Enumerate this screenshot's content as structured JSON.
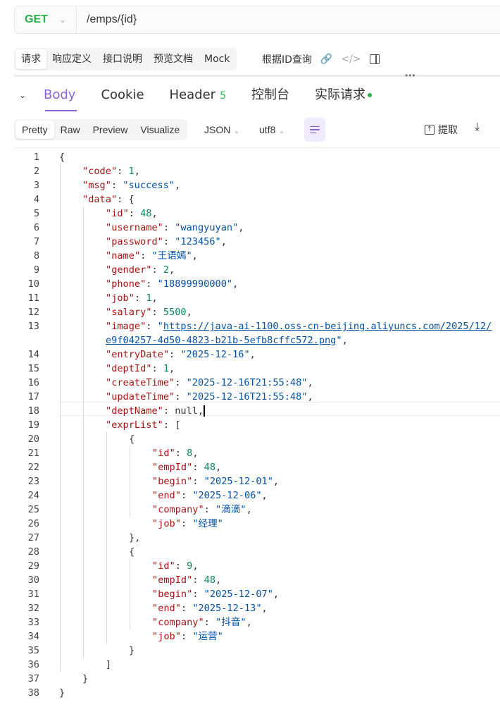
{
  "request": {
    "method": "GET",
    "url": "/emps/{id}"
  },
  "request_tabs": [
    "请求",
    "响应定义",
    "接口说明",
    "预览文档",
    "Mock"
  ],
  "request_extra": {
    "label": "根据ID查询"
  },
  "response_tabs": {
    "body": "Body",
    "cookie": "Cookie",
    "header": "Header",
    "header_count": "5",
    "console": "控制台",
    "actual_request": "实际请求"
  },
  "format_tabs": [
    "Pretty",
    "Raw",
    "Preview",
    "Visualize"
  ],
  "format_select": {
    "type": "JSON",
    "encoding": "utf8"
  },
  "toolbar": {
    "extract": "提取"
  },
  "icons": {
    "method_dropdown": "chevron-down-icon",
    "link": "link-icon",
    "code": "code-icon",
    "panel": "panel-layout-icon",
    "collapse": "chevron-down-icon",
    "wrap": "wrap-lines-icon",
    "extract": "extract-icon",
    "download": "download-icon"
  },
  "colors": {
    "method_get": "#2db24b",
    "accent": "#8a63d2",
    "json_key": "#a31515",
    "json_string": "#0451a5",
    "json_number": "#098658"
  },
  "code": {
    "current_line": 18,
    "lines": [
      {
        "n": "1",
        "t": "{"
      },
      {
        "n": "2",
        "k": "code",
        "v": "1",
        "vt": "n",
        "e": ","
      },
      {
        "n": "3",
        "k": "msg",
        "v": "\"success\"",
        "vt": "s",
        "e": ","
      },
      {
        "n": "4",
        "k": "data",
        "v": "{",
        "vt": "p",
        "e": ""
      },
      {
        "n": "5",
        "k": "id",
        "v": "48",
        "vt": "n",
        "e": ","
      },
      {
        "n": "6",
        "k": "username",
        "v": "\"wangyuyan\"",
        "vt": "s",
        "e": ","
      },
      {
        "n": "7",
        "k": "password",
        "v": "\"123456\"",
        "vt": "s",
        "e": ","
      },
      {
        "n": "8",
        "k": "name",
        "v": "\"王语嫣\"",
        "vt": "s",
        "e": ","
      },
      {
        "n": "9",
        "k": "gender",
        "v": "2",
        "vt": "n",
        "e": ","
      },
      {
        "n": "10",
        "k": "phone",
        "v": "\"18899990000\"",
        "vt": "s",
        "e": ","
      },
      {
        "n": "11",
        "k": "job",
        "v": "1",
        "vt": "n",
        "e": ","
      },
      {
        "n": "12",
        "k": "salary",
        "v": "5500",
        "vt": "n",
        "e": ","
      },
      {
        "n": "13",
        "k": "image",
        "v": "\"",
        "vt": "s",
        "link1": "https://java-ai-1100.oss-cn-beijing.aliyuncs.com/2025/12/",
        "e": ""
      },
      {
        "n": "",
        "link2": "e9f04257-4d50-4823-b21b-5efb8cffc572.png",
        "tail": "\"",
        "e": ","
      },
      {
        "n": "14",
        "k": "entryDate",
        "v": "\"2025-12-16\"",
        "vt": "s",
        "e": ","
      },
      {
        "n": "15",
        "k": "deptId",
        "v": "1",
        "vt": "n",
        "e": ","
      },
      {
        "n": "16",
        "k": "createTime",
        "v": "\"2025-12-16T21:55:48\"",
        "vt": "s",
        "e": ","
      },
      {
        "n": "17",
        "k": "updateTime",
        "v": "\"2025-12-16T21:55:48\"",
        "vt": "s",
        "e": ","
      },
      {
        "n": "18",
        "k": "deptName",
        "v": "null",
        "vt": "p",
        "e": ","
      },
      {
        "n": "19",
        "k": "exprList",
        "v": "[",
        "vt": "p",
        "e": ""
      },
      {
        "n": "20",
        "t": "{"
      },
      {
        "n": "21",
        "k": "id",
        "v": "8",
        "vt": "n",
        "e": ","
      },
      {
        "n": "22",
        "k": "empId",
        "v": "48",
        "vt": "n",
        "e": ","
      },
      {
        "n": "23",
        "k": "begin",
        "v": "\"2025-12-01\"",
        "vt": "s",
        "e": ","
      },
      {
        "n": "24",
        "k": "end",
        "v": "\"2025-12-06\"",
        "vt": "s",
        "e": ","
      },
      {
        "n": "25",
        "k": "company",
        "v": "\"滴滴\"",
        "vt": "s",
        "e": ","
      },
      {
        "n": "26",
        "k": "job",
        "v": "\"经理\"",
        "vt": "s",
        "e": ""
      },
      {
        "n": "27",
        "t": "},"
      },
      {
        "n": "28",
        "t": "{"
      },
      {
        "n": "29",
        "k": "id",
        "v": "9",
        "vt": "n",
        "e": ","
      },
      {
        "n": "30",
        "k": "empId",
        "v": "48",
        "vt": "n",
        "e": ","
      },
      {
        "n": "31",
        "k": "begin",
        "v": "\"2025-12-07\"",
        "vt": "s",
        "e": ","
      },
      {
        "n": "32",
        "k": "end",
        "v": "\"2025-12-13\"",
        "vt": "s",
        "e": ","
      },
      {
        "n": "33",
        "k": "company",
        "v": "\"抖音\"",
        "vt": "s",
        "e": ","
      },
      {
        "n": "34",
        "k": "job",
        "v": "\"运营\"",
        "vt": "s",
        "e": ""
      },
      {
        "n": "35",
        "t": "}"
      },
      {
        "n": "36",
        "t": "]"
      },
      {
        "n": "37",
        "t": "}"
      },
      {
        "n": "38",
        "t": "}"
      }
    ]
  }
}
